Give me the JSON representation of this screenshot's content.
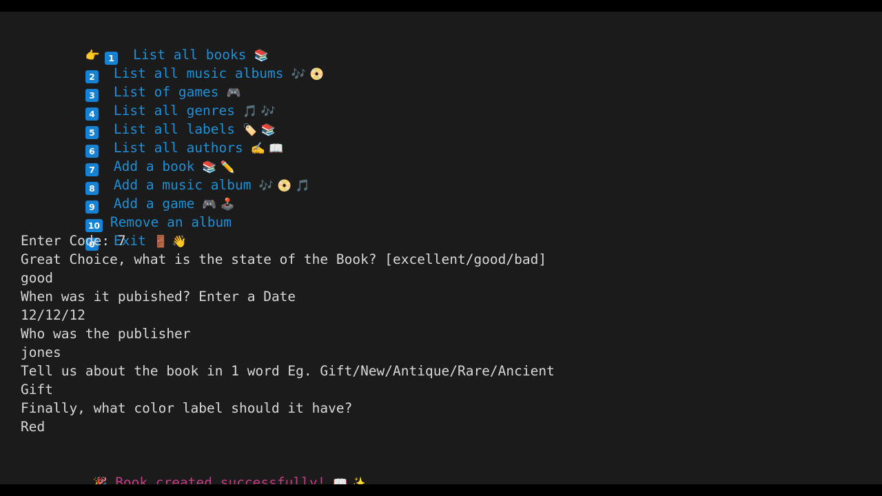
{
  "terminal": {
    "background_color": "#1b1b1b",
    "frame_color": "#000000",
    "menu_color": "#1f8fd6",
    "output_color": "#d8d8d8",
    "success_color": "#c53c83",
    "badge_color": "#1682d4"
  },
  "menu": {
    "selected_index": 0,
    "pointer_icon": "👉",
    "items": [
      {
        "key": "1",
        "label": "List all books",
        "icons": "📚",
        "selected": true
      },
      {
        "key": "2",
        "label": "List all music albums",
        "icons": "🎶 📀",
        "selected": false
      },
      {
        "key": "3",
        "label": "List of games",
        "icons": "🎮",
        "selected": false
      },
      {
        "key": "4",
        "label": "List all genres",
        "icons": "🎵 🎶",
        "selected": false
      },
      {
        "key": "5",
        "label": "List all labels",
        "icons": "🏷️ 📚",
        "selected": false
      },
      {
        "key": "6",
        "label": "List all authors",
        "icons": "✍️ 📖",
        "selected": false
      },
      {
        "key": "7",
        "label": "Add a book",
        "icons": "📚 ✏️",
        "selected": false
      },
      {
        "key": "8",
        "label": "Add a music album",
        "icons": "🎶 📀 🎵",
        "selected": false
      },
      {
        "key": "9",
        "label": "Add a game",
        "icons": "🎮 🕹️",
        "selected": false
      },
      {
        "key": "10",
        "label": "Remove an album",
        "icons": "",
        "selected": false
      },
      {
        "key": "0",
        "label": "Exit",
        "icons": "🚪 👋",
        "selected": false
      }
    ]
  },
  "session": {
    "prompt_code": "Enter Code: 7",
    "lines": [
      {
        "id": "state_prompt",
        "text": "Great Choice, what is the state of the Book? [excellent/good/bad]",
        "kind": "prompt"
      },
      {
        "id": "state_answer",
        "text": "good",
        "kind": "answer"
      },
      {
        "id": "date_prompt",
        "text": "When was it pubished? Enter a Date",
        "kind": "prompt"
      },
      {
        "id": "date_answer",
        "text": "12/12/12",
        "kind": "answer"
      },
      {
        "id": "publisher_prompt",
        "text": "Who was the publisher",
        "kind": "prompt"
      },
      {
        "id": "publisher_answer",
        "text": "jones",
        "kind": "answer"
      },
      {
        "id": "word_prompt",
        "text": "Tell us about the book in 1 word Eg. Gift/New/Antique/Rare/Ancient",
        "kind": "prompt"
      },
      {
        "id": "word_answer",
        "text": "Gift",
        "kind": "answer"
      },
      {
        "id": "color_prompt",
        "text": "Finally, what color label should it have?",
        "kind": "prompt"
      },
      {
        "id": "color_answer",
        "text": "Red",
        "kind": "answer"
      }
    ]
  },
  "result": {
    "leading_icon": "🎉",
    "message": "Book created successfully!",
    "trailing_icons": "📖 ✨"
  }
}
